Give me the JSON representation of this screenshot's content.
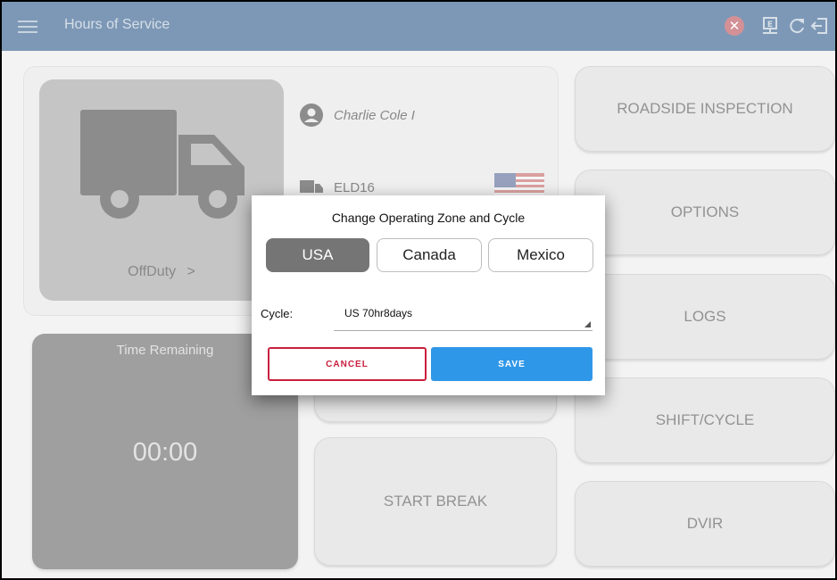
{
  "app": {
    "title": "Hours of Service"
  },
  "toolbar": {
    "icons": [
      "close-circle-icon",
      "device-sync-icon",
      "refresh-icon",
      "logout-icon"
    ]
  },
  "status": {
    "driver_name": "Charlie Cole I",
    "vehicle": "ELD16",
    "duty_status": "OffDuty",
    "duty_chevron": ">",
    "time_remaining_label": "Time Remaining",
    "time_remaining_value": "00:00"
  },
  "center_buttons": {
    "start_break": "START BREAK"
  },
  "side_buttons": [
    "ROADSIDE INSPECTION",
    "OPTIONS",
    "LOGS",
    "SHIFT/CYCLE",
    "DVIR"
  ],
  "dialog": {
    "title": "Change Operating Zone and Cycle",
    "zones": [
      "USA",
      "Canada",
      "Mexico"
    ],
    "selected_zone": "USA",
    "cycle_label": "Cycle:",
    "cycle_value": "US 70hr8days",
    "cancel_label": "CANCEL",
    "save_label": "SAVE"
  },
  "colors": {
    "topbar": "#1f4f82",
    "save": "#2f97e8",
    "cancel": "#c9203e",
    "zone_selected": "#757575"
  }
}
